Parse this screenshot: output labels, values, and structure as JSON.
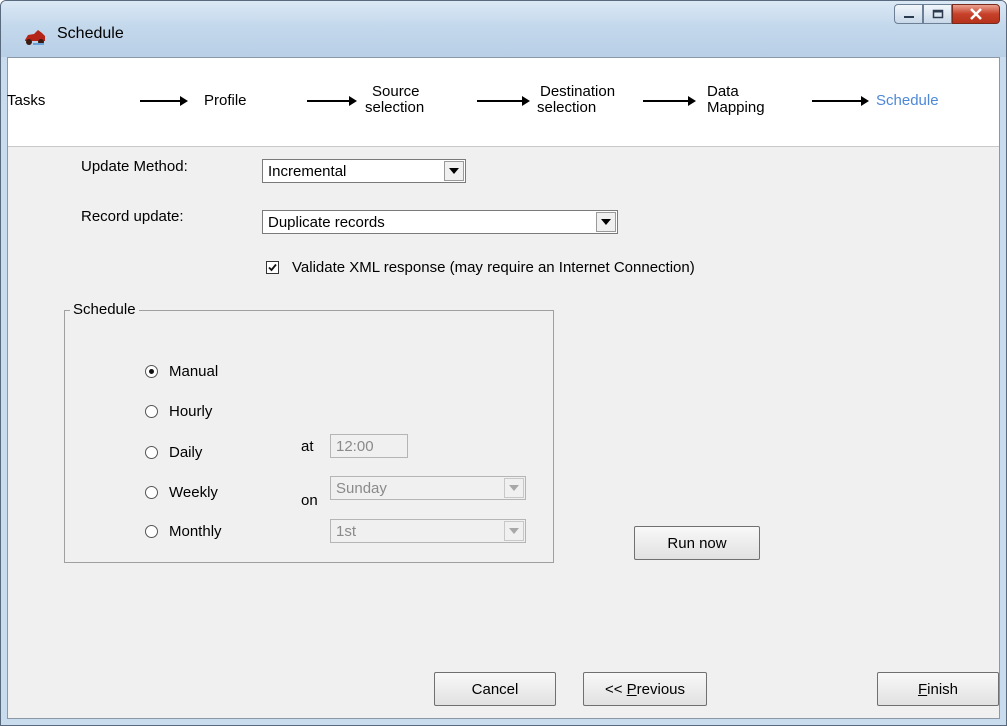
{
  "window": {
    "title": "Schedule"
  },
  "wizard": {
    "steps": [
      {
        "line1": "Tasks",
        "line2": ""
      },
      {
        "line1": "Profile",
        "line2": ""
      },
      {
        "line1": "Source",
        "line2": "selection"
      },
      {
        "line1": "Destination",
        "line2": "selection"
      },
      {
        "line1": "Data",
        "line2": "Mapping"
      },
      {
        "line1": "Schedule",
        "line2": ""
      }
    ],
    "active_color": "#4d88d8"
  },
  "form": {
    "update_method_label": "Update Method:",
    "update_method_value": "Incremental",
    "record_update_label": "Record update:",
    "record_update_value": "Duplicate records",
    "validate_label": "Validate XML response (may require an Internet Connection)",
    "validate_checked": true
  },
  "schedule": {
    "group_title": "Schedule",
    "options": [
      "Manual",
      "Hourly",
      "Daily",
      "Weekly",
      "Monthly"
    ],
    "selected": "Manual",
    "at_label": "at",
    "at_value": "12:00",
    "on_label": "on",
    "day_value": "Sunday",
    "month_day_value": "1st"
  },
  "buttons": {
    "run_now": "Run now",
    "cancel": "Cancel",
    "previous_prefix": "<< ",
    "previous_mnemonic": "P",
    "previous_rest": "revious",
    "finish_mnemonic": "F",
    "finish_rest": "inish"
  }
}
